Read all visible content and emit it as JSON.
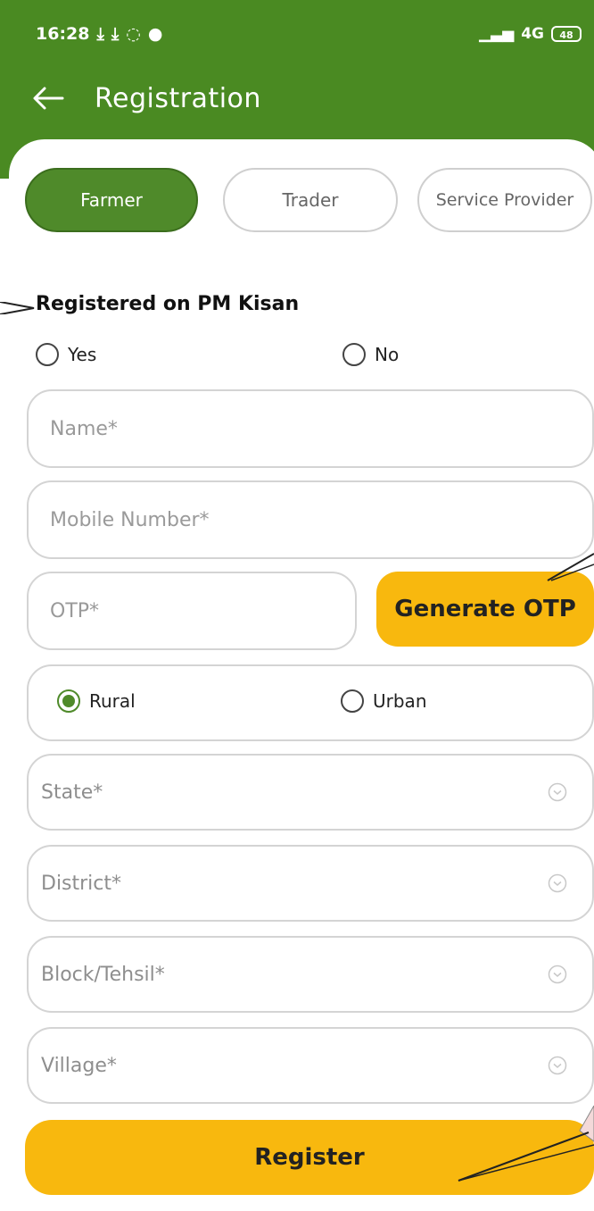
{
  "status_bar": {
    "time": "16:28",
    "network": "4G",
    "battery": "48"
  },
  "header": {
    "title": "Registration"
  },
  "roles": {
    "tabs": [
      {
        "label": "Farmer",
        "active": true
      },
      {
        "label": "Trader",
        "active": false
      },
      {
        "label": "Service Provider",
        "active": false
      }
    ]
  },
  "pm_kisan": {
    "title": "Registered on PM Kisan",
    "options": [
      {
        "label": "Yes",
        "checked": false
      },
      {
        "label": "No",
        "checked": false
      }
    ]
  },
  "form": {
    "name_placeholder": "Name*",
    "mobile_placeholder": "Mobile Number*",
    "otp_placeholder": "OTP*",
    "generate_otp_label": "Generate OTP",
    "area_options": [
      {
        "label": "Rural",
        "checked": true
      },
      {
        "label": "Urban",
        "checked": false
      }
    ],
    "state_placeholder": "State*",
    "district_placeholder": "District*",
    "block_placeholder": "Block/Tehsil*",
    "village_placeholder": "Village*",
    "register_label": "Register"
  },
  "colors": {
    "header_green": "#4a8a22",
    "accent_yellow": "#f8b80e",
    "active_tab": "#4f8a2a"
  }
}
